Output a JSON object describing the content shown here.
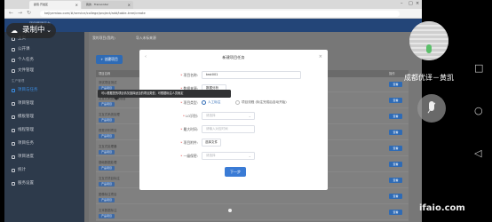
{
  "browser": {
    "tabs": [
      {
        "label": "颜值·开发区"
      },
      {
        "label": "我的 · Transcoder"
      }
    ],
    "url": "kejiyemiao.com/#/service/college/project/add/table-tree/create",
    "app_title": "项目管理平台"
  },
  "sidebar": {
    "items": [
      {
        "label": "主页"
      },
      {
        "label": "公开课"
      },
      {
        "label": "个人任务"
      },
      {
        "label": "文件管理"
      }
    ],
    "group_label": "生产管理",
    "items2": [
      {
        "label": "项目与任务"
      },
      {
        "label": "项目管理"
      },
      {
        "label": "模板管理"
      },
      {
        "label": "线程管理"
      },
      {
        "label": "项目任务"
      },
      {
        "label": "项目进度"
      },
      {
        "label": "统计"
      },
      {
        "label": "服务设置"
      }
    ]
  },
  "content": {
    "tabs": [
      "我的项目(我的)",
      "导入未标来源"
    ],
    "new_button": "+ 创建项目",
    "table_headers": [
      "项目名称",
      "状态",
      "操作"
    ],
    "rows": [
      {
        "name": "测试项目测试",
        "tag": "产品项目",
        "action": "查看"
      },
      {
        "name": "交互式系统系统项目",
        "tag": "产品项目",
        "action": "查看"
      },
      {
        "name": "交互式系统处理",
        "tag": "产品项目",
        "action": "查看"
      },
      {
        "name": "视觉识别项目",
        "tag": "产品项目",
        "action": "查看"
      },
      {
        "name": "交互式处理器",
        "tag": "产品项目",
        "action": "查看"
      },
      {
        "name": "基础数据处理",
        "tag": "产品项目",
        "action": "查看"
      },
      {
        "name": "交互式项目标注",
        "tag": "产品项目",
        "action": "查看"
      },
      {
        "name": "图像标注项目",
        "tag": "产品项目",
        "action": "查看"
      },
      {
        "name": "文本数据标注",
        "tag": "产品项目",
        "action": "查看"
      }
    ]
  },
  "modal": {
    "title": "新建项目任务",
    "fields": {
      "name_label": "项目名称:",
      "name_value": "test001",
      "data_label": "数据来源:",
      "data_value": "数据分析",
      "type_label": "项目类型:",
      "type_option1": "人工标注",
      "type_option2": "项目流程 (标注完成后自动开始)",
      "lo_label": "LO识别:",
      "lo_placeholder": "请选择",
      "count_label": "最大时间:",
      "count_placeholder": "请输入对应时间",
      "file_label": "项目附件:",
      "file_button": "选择文件",
      "class_label": "一级保密:",
      "class_placeholder": "请选择"
    },
    "tooltip": "可以根据您的项目情况选择适当的项目类型，可根据标注人员而定",
    "next_button": "下一步"
  },
  "overlay": {
    "recording_label": "录制中",
    "caption": "成都优译－黄凯",
    "watermark": "ifaio.com"
  },
  "colors": {
    "primary": "#2f6bb5",
    "sidebar_bg": "#2d3a4b",
    "header_bg": "#234578",
    "tooltip_bg": "#303133"
  }
}
